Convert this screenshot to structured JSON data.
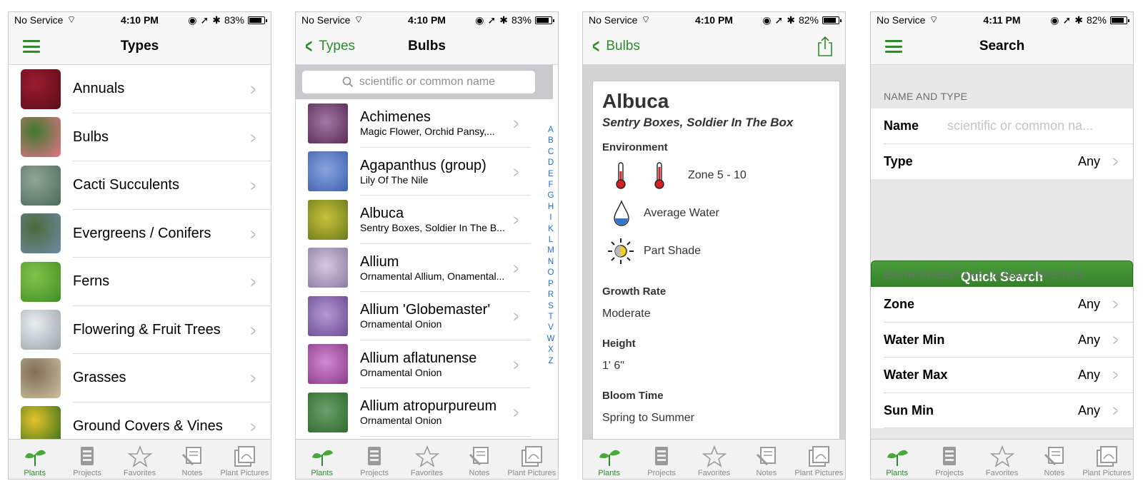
{
  "status": {
    "carrier": "No Service",
    "screens": [
      {
        "time": "4:10 PM",
        "battery": "83%"
      },
      {
        "time": "4:10 PM",
        "battery": "83%"
      },
      {
        "time": "4:10 PM",
        "battery": "82%"
      },
      {
        "time": "4:11 PM",
        "battery": "82%"
      }
    ]
  },
  "colors": {
    "accent": "#2e8a2e",
    "index_blue": "#1a6fd6",
    "quick_search": "#3a8c2e"
  },
  "tabs": [
    "Plants",
    "Projects",
    "Favorites",
    "Notes",
    "Plant Pictures"
  ],
  "types": {
    "title": "Types",
    "items": [
      "Annuals",
      "Bulbs",
      "Cacti Succulents",
      "Evergreens / Conifers",
      "Ferns",
      "Flowering & Fruit Trees",
      "Grasses",
      "Ground Covers & Vines"
    ]
  },
  "bulbs": {
    "back_label": "Types",
    "title": "Bulbs",
    "search_placeholder": "scientific or common name",
    "items": [
      {
        "name": "Achimenes",
        "common": "Magic Flower, Orchid Pansy,..."
      },
      {
        "name": "Agapanthus (group)",
        "common": "Lily Of The Nile"
      },
      {
        "name": "Albuca",
        "common": "Sentry Boxes, Soldier In The B..."
      },
      {
        "name": "Allium",
        "common": "Ornamental Allium, Onamental..."
      },
      {
        "name": "Allium 'Globemaster'",
        "common": "Ornamental Onion"
      },
      {
        "name": "Allium aflatunense",
        "common": "Ornamental Onion"
      },
      {
        "name": "Allium atropurpureum",
        "common": "Ornamental Onion"
      }
    ],
    "index": [
      "A",
      "B",
      "C",
      "D",
      "E",
      "F",
      "G",
      "H",
      "I",
      "K",
      "L",
      "M",
      "N",
      "O",
      "P",
      "R",
      "S",
      "T",
      "V",
      "W",
      "X",
      "Z"
    ]
  },
  "detail": {
    "back_label": "Bulbs",
    "name": "Albuca",
    "common": "Sentry Boxes, Soldier In The Box",
    "environment_label": "Environment",
    "zone": "Zone 5 - 10",
    "water": "Average Water",
    "sun": "Part Shade",
    "growth_rate_label": "Growth Rate",
    "growth_rate": "Moderate",
    "height_label": "Height",
    "height": "1' 6\"",
    "bloom_label": "Bloom Time",
    "bloom": "Spring to Summer"
  },
  "search": {
    "title": "Search",
    "section1": "NAME AND TYPE",
    "name_label": "Name",
    "name_placeholder": "scientific or common na...",
    "type_label": "Type",
    "type_value": "Any",
    "quick_search": "Quick Search",
    "section2": "ENVIRONMENT AND CHARACTERISTICS",
    "fields": [
      {
        "label": "Zone",
        "value": "Any"
      },
      {
        "label": "Water Min",
        "value": "Any"
      },
      {
        "label": "Water Max",
        "value": "Any"
      },
      {
        "label": "Sun Min",
        "value": "Any"
      }
    ]
  }
}
